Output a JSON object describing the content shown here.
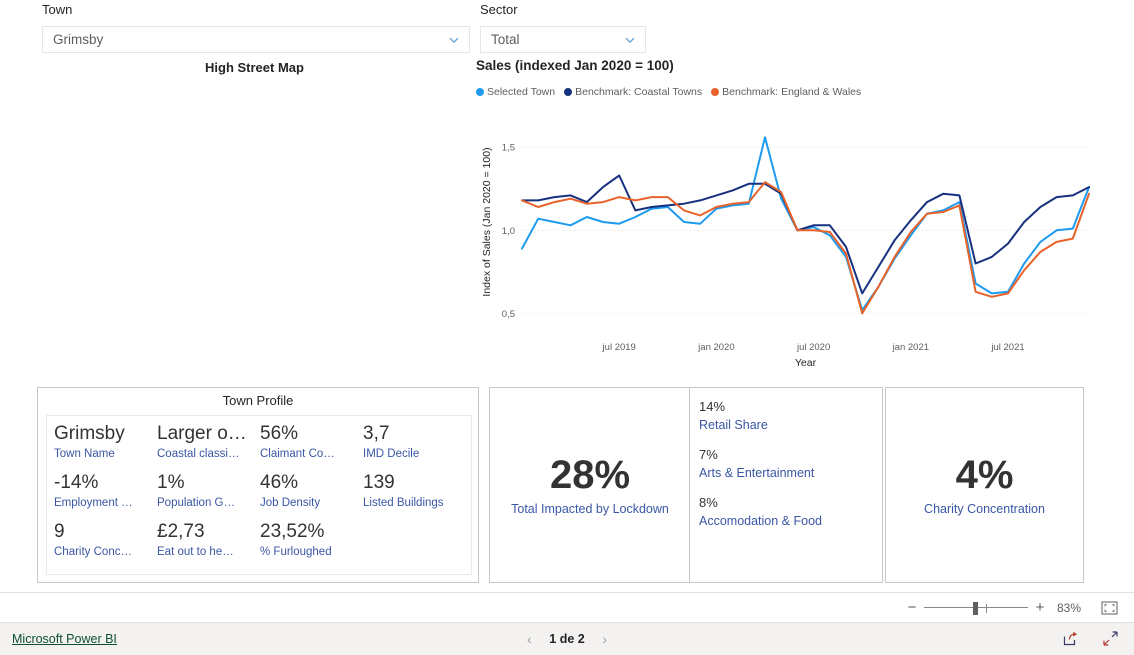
{
  "slicers": {
    "town": {
      "label": "Town",
      "value": "Grimsby",
      "icon": "chevron-down-icon"
    },
    "sector": {
      "label": "Sector",
      "value": "Total",
      "icon": "chevron-down-icon"
    }
  },
  "map_visual": {
    "title": "High Street Map"
  },
  "chart_data": {
    "type": "line",
    "title": "Sales (indexed Jan 2020 = 100)",
    "xlabel": "Year",
    "ylabel": "Index of Sales (Jan 2020 = 100)",
    "ylim": [
      0.4,
      1.7
    ],
    "yticks": [
      0.5,
      1.0,
      1.5
    ],
    "ytick_labels": [
      "0,5",
      "1,0",
      "1,5"
    ],
    "xtick_labels": [
      "jul 2019",
      "jan 2020",
      "jul 2020",
      "jan 2021",
      "jul 2021"
    ],
    "xtick_positions": [
      6,
      12,
      18,
      24,
      30
    ],
    "grid": true,
    "legend_position": "top",
    "x": [
      0,
      1,
      2,
      3,
      4,
      5,
      6,
      7,
      8,
      9,
      10,
      11,
      12,
      13,
      14,
      15,
      16,
      17,
      18,
      19,
      20,
      21,
      22,
      23,
      24,
      25,
      26,
      27,
      28,
      29,
      30,
      31,
      32,
      33,
      34,
      35
    ],
    "series": [
      {
        "name": "Selected Town",
        "color": "#1E9BEF",
        "values": [
          0.89,
          1.07,
          1.05,
          1.03,
          1.08,
          1.05,
          1.04,
          1.08,
          1.13,
          1.14,
          1.05,
          1.04,
          1.13,
          1.15,
          1.16,
          1.56,
          1.19,
          1.0,
          1.02,
          0.97,
          0.84,
          0.52,
          0.66,
          0.83,
          0.97,
          1.1,
          1.12,
          1.17,
          0.68,
          0.62,
          0.63,
          0.8,
          0.93,
          1.0,
          1.01,
          1.26
        ]
      },
      {
        "name": "Benchmark: Coastal Towns",
        "color": "#17317F",
        "values": [
          1.18,
          1.18,
          1.2,
          1.21,
          1.17,
          1.26,
          1.33,
          1.12,
          1.14,
          1.15,
          1.16,
          1.18,
          1.21,
          1.24,
          1.28,
          1.28,
          1.22,
          1.0,
          1.03,
          1.03,
          0.9,
          0.62,
          0.78,
          0.94,
          1.06,
          1.17,
          1.22,
          1.21,
          0.8,
          0.84,
          0.92,
          1.05,
          1.14,
          1.2,
          1.21,
          1.26
        ]
      },
      {
        "name": "Benchmark: England & Wales",
        "color": "#E8622A",
        "values": [
          1.18,
          1.14,
          1.17,
          1.19,
          1.16,
          1.17,
          1.2,
          1.18,
          1.2,
          1.2,
          1.12,
          1.09,
          1.14,
          1.16,
          1.17,
          1.29,
          1.23,
          1.0,
          1.0,
          0.99,
          0.86,
          0.5,
          0.66,
          0.84,
          0.99,
          1.1,
          1.11,
          1.15,
          0.63,
          0.6,
          0.62,
          0.76,
          0.87,
          0.93,
          0.95,
          1.22
        ]
      }
    ]
  },
  "town_profile": {
    "title": "Town Profile",
    "tiles": [
      {
        "value": "Grimsby",
        "label": "Town Name"
      },
      {
        "value": "Larger o…",
        "label": "Coastal classi…"
      },
      {
        "value": "56%",
        "label": "Claimant Co…"
      },
      {
        "value": "3,7",
        "label": "IMD Decile"
      },
      {
        "value": "-14%",
        "label": "Employment …"
      },
      {
        "value": "1%",
        "label": "Population G…"
      },
      {
        "value": "46%",
        "label": "Job Density"
      },
      {
        "value": "139",
        "label": "Listed Buildings"
      },
      {
        "value": "9",
        "label": "Charity Conc…"
      },
      {
        "value": "£2,73",
        "label": "Eat out to he…"
      },
      {
        "value": "23,52%",
        "label": "% Furloughed"
      }
    ]
  },
  "kpis": {
    "lockdown": {
      "value": "28%",
      "label": "Total Impacted by Lockdown"
    },
    "charity": {
      "value": "4%",
      "label": "Charity Concentration"
    },
    "sectors": [
      {
        "value": "14%",
        "label": "Retail Share"
      },
      {
        "value": "7%",
        "label": "Arts & Entertainment"
      },
      {
        "value": "8%",
        "label": "Accomodation & Food"
      }
    ]
  },
  "zoombar": {
    "minus": "−",
    "plus": "+",
    "percent": "83%",
    "fit_icon": "fit-to-page-icon"
  },
  "footer": {
    "brand": "Microsoft Power BI",
    "prev_icon": "chevron-left-icon",
    "next_icon": "chevron-right-icon",
    "page_text": "1 de 2",
    "share_icon": "share-icon",
    "fullscreen_icon": "fullscreen-icon"
  }
}
